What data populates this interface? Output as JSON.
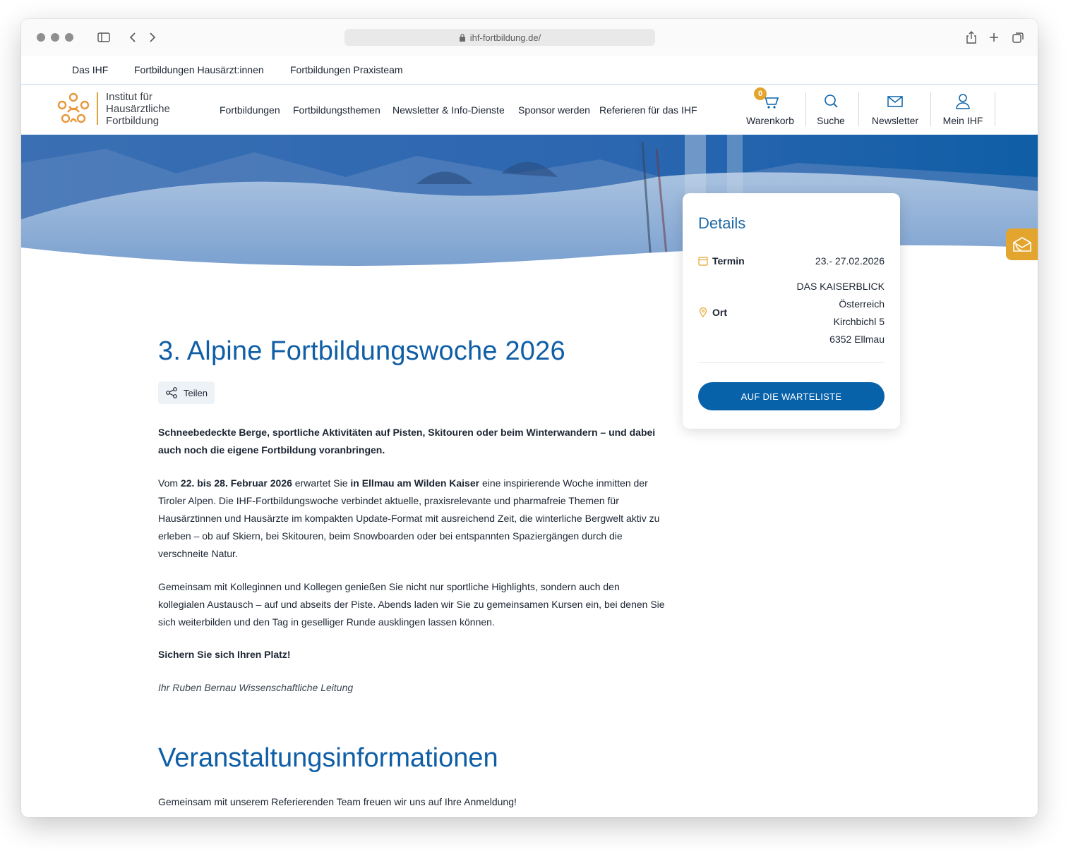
{
  "browser": {
    "url": "ihf-fortbildung.de/"
  },
  "topnav": {
    "items": [
      "Das IHF",
      "Fortbildungen Hausärzt:innen",
      "Fortbildungen Praxisteam"
    ]
  },
  "logo": {
    "line1": "Institut für",
    "line2": "Hausärztliche",
    "line3": "Fortbildung"
  },
  "mainnav": {
    "items": [
      "Fortbildungen",
      "Fortbildungsthemen",
      "Newsletter & Info-Dienste",
      "Sponsor werden",
      "Referieren für das IHF"
    ]
  },
  "header_icons": {
    "cart": "Warenkorb",
    "cart_count": "0",
    "search": "Suche",
    "newsletter": "Newsletter",
    "account": "Mein IHF"
  },
  "details": {
    "title": "Details",
    "termin_label": "Termin",
    "termin_value": "23.- 27.02.2026",
    "ort_label": "Ort",
    "ort_lines": [
      "DAS KAISERBLICK",
      "Österreich",
      "Kirchbichl 5",
      "6352 Ellmau"
    ],
    "button": "AUF DIE WARTELISTE"
  },
  "content": {
    "title": "3. Alpine Fortbildungswoche 2026",
    "share": "Teilen",
    "intro": "Schneebedeckte Berge, sportliche Aktivitäten auf Pisten, Skitouren oder beim Winterwandern – und dabei auch noch die eigene Fortbildung voranbringen.",
    "p1_a": "Vom ",
    "p1_b": "22. bis 28. Februar 2026",
    "p1_c": " erwartet Sie ",
    "p1_d": "in Ellmau am Wilden Kaiser",
    "p1_e": " eine inspirierende Woche inmitten der Tiroler Alpen. Die IHF-Fortbildungswoche verbindet aktuelle, praxisrelevante und pharmafreie Themen für Hausärztinnen und Hausärzte im kompakten Update-Format mit ausreichend Zeit, die winterliche Bergwelt aktiv zu erleben – ob auf Skiern, bei Skitouren, beim Snowboarden oder bei entspannten Spaziergängen durch die verschneite Natur.",
    "p2": "Gemeinsam mit Kolleginnen und Kollegen genießen Sie nicht nur sportliche Highlights, sondern auch den kollegialen Austausch – auf und abseits der Piste. Abends laden wir Sie zu gemeinsamen Kursen ein, bei denen Sie sich weiterbilden und den Tag in geselliger Runde ausklingen lassen können.",
    "cta": "Sichern Sie sich Ihren Platz!",
    "signature": "Ihr Ruben Bernau Wissenschaftliche Leitung",
    "section_title": "Veranstaltungsinformationen",
    "section_intro": "Gemeinsam mit unserem Referierenden Team freuen wir uns auf Ihre Anmeldung!"
  },
  "colors": {
    "brand_blue": "#0862aa",
    "heading_blue": "#0f5ea6",
    "accent_orange": "#e4a52f"
  }
}
